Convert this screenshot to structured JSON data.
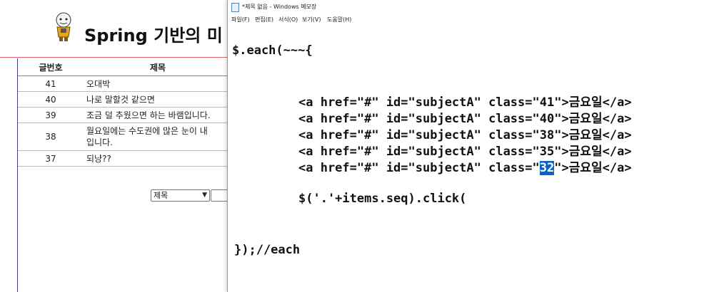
{
  "background_page": {
    "site_title": "Spring 기반의 미",
    "table": {
      "headers": [
        "글번호",
        "제목"
      ],
      "rows": [
        {
          "num": "41",
          "subject": [
            "오대박"
          ]
        },
        {
          "num": "40",
          "subject": [
            "나로 말할것 같으면"
          ]
        },
        {
          "num": "39",
          "subject": [
            "조금 덜 추웠으면 하는 바램입니다."
          ]
        },
        {
          "num": "38",
          "subject": [
            "월요일에는 수도권에 많은 눈이 내",
            "입니다."
          ]
        },
        {
          "num": "37",
          "subject": [
            "되냥??"
          ]
        }
      ]
    },
    "search": {
      "select_value": "제목"
    }
  },
  "notepad": {
    "title": "*제목 없음 - Windows 메모장",
    "menu": [
      "파일(F)",
      "편집(E)",
      "서식(O)",
      "보기(V)",
      "도움말(H)"
    ],
    "code": {
      "line1": "$.each(~~~{",
      "anchor_prefix": "<a href=\"#\" id=\"subjectA\" class=\"",
      "anchor_suffix": "\">금요일</a>",
      "classes": [
        "41",
        "40",
        "38",
        "35",
        "32"
      ],
      "click_line": "$('.'+items.seq).click(",
      "end_line": "});//each"
    },
    "selection_color": "#0a64c8"
  }
}
